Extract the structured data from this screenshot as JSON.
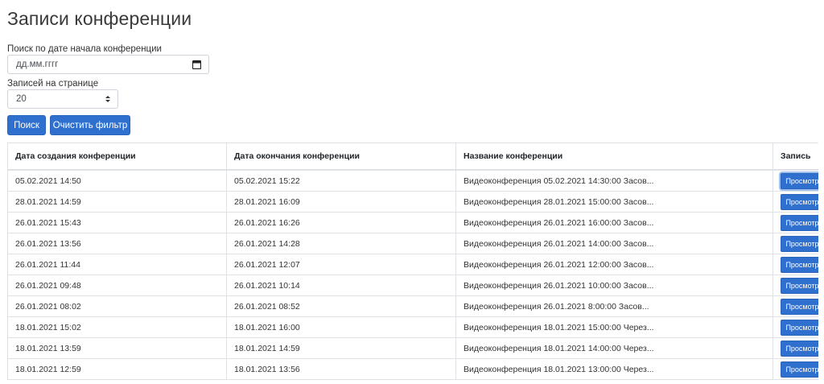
{
  "page": {
    "title": "Записи конференции"
  },
  "filters": {
    "date_label": "Поиск по дате начала конференции",
    "date_placeholder": "дд.мм.гггг",
    "per_page_label": "Записей на странице",
    "per_page_value": "20",
    "search_button": "Поиск",
    "clear_button": "Очистить фильтр"
  },
  "table": {
    "headers": [
      "Дата создания конференции",
      "Дата окончания конференции",
      "Название конференции",
      "Запись"
    ],
    "view_label": "Просмотр",
    "rows": [
      [
        "05.02.2021 14:50",
        "05.02.2021 15:22",
        "Видеоконференция 05.02.2021 14:30:00 Засов..."
      ],
      [
        "28.01.2021 14:59",
        "28.01.2021 16:09",
        "Видеоконференция 28.01.2021 15:00:00 Засов..."
      ],
      [
        "26.01.2021 15:43",
        "26.01.2021 16:26",
        "Видеоконференция 26.01.2021 16:00:00 Засов..."
      ],
      [
        "26.01.2021 13:56",
        "26.01.2021 14:28",
        "Видеоконференция 26.01.2021 14:00:00 Засов..."
      ],
      [
        "26.01.2021 11:44",
        "26.01.2021 12:07",
        "Видеоконференция 26.01.2021 12:00:00 Засов..."
      ],
      [
        "26.01.2021 09:48",
        "26.01.2021 10:14",
        "Видеоконференция 26.01.2021 10:00:00 Засов..."
      ],
      [
        "26.01.2021 08:02",
        "26.01.2021 08:52",
        "Видеоконференция 26.01.2021 8:00:00 Засов..."
      ],
      [
        "18.01.2021 15:02",
        "18.01.2021 16:00",
        "Видеоконференция 18.01.2021 15:00:00 Через..."
      ],
      [
        "18.01.2021 13:59",
        "18.01.2021 14:59",
        "Видеоконференция 18.01.2021 14:00:00 Через..."
      ],
      [
        "18.01.2021 12:59",
        "18.01.2021 13:56",
        "Видеоконференция 18.01.2021 13:00:00 Через..."
      ]
    ]
  }
}
